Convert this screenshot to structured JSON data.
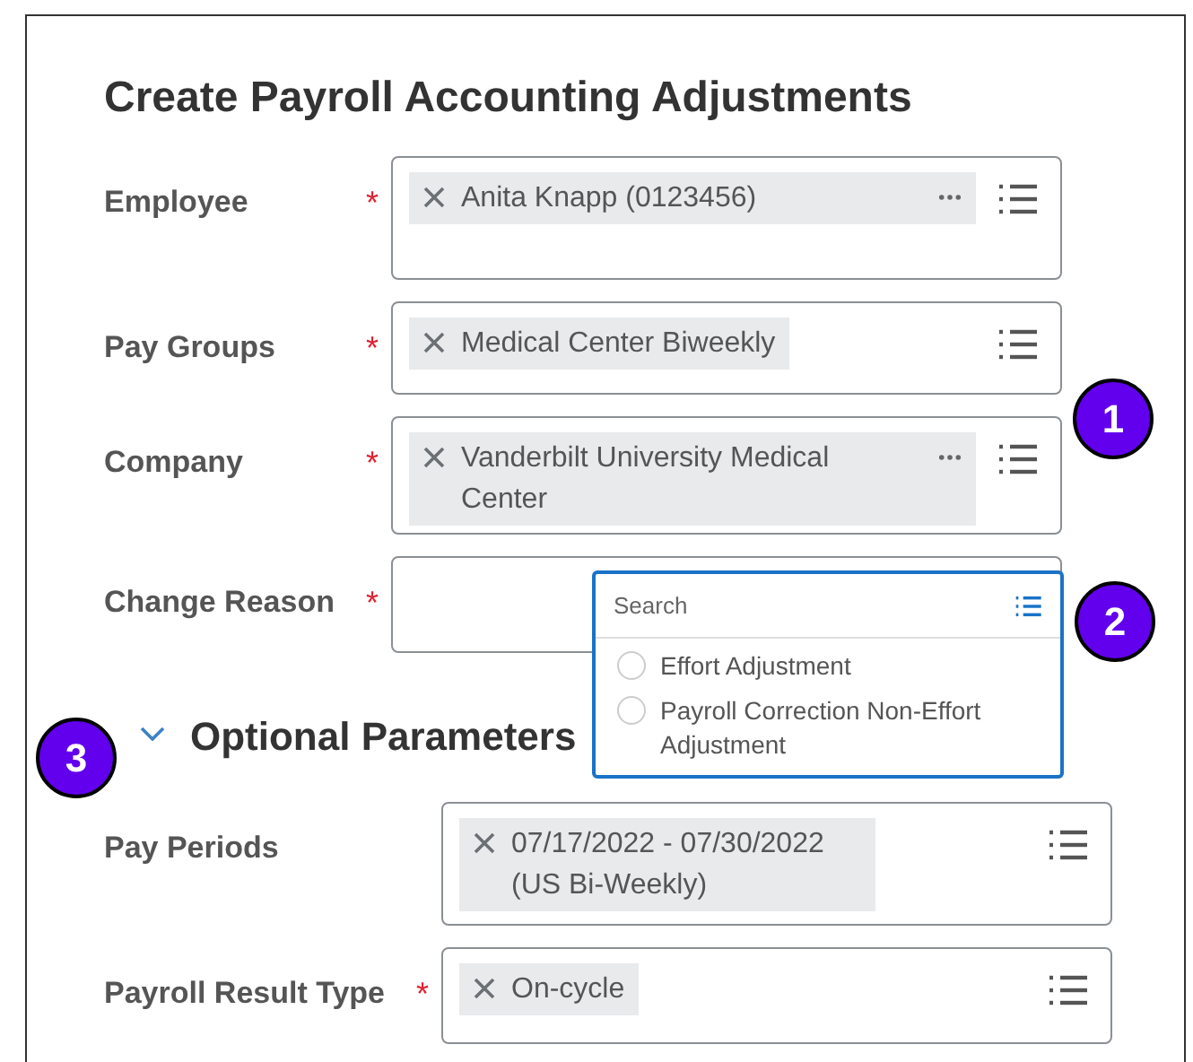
{
  "title": "Create Payroll Accounting Adjustments",
  "fields": [
    {
      "label": "Employee",
      "required_mark": "*",
      "values": [
        {
          "text": "Anita Knapp (0123456)",
          "more": true
        }
      ]
    },
    {
      "label": "Pay Groups",
      "required_mark": "*",
      "values": [
        {
          "text": "Medical Center Biweekly",
          "more": false
        }
      ]
    },
    {
      "label": "Company",
      "required_mark": "*",
      "values": [
        {
          "text": "Vanderbilt University Medical Center",
          "more": true
        }
      ]
    },
    {
      "label": "Change Reason",
      "required_mark": "*"
    }
  ],
  "dropdown": {
    "placeholder": "Search",
    "options": [
      {
        "label": "Effort Adjustment",
        "selected": false
      },
      {
        "label": "Payroll Correction Non-Effort Adjustment",
        "selected": false
      }
    ]
  },
  "optional_section": {
    "title": "Optional Parameters",
    "expanded": true,
    "fields": [
      {
        "label": "Pay Periods",
        "values": [
          {
            "text": "07/17/2022 - 07/30/2022 (US Bi-Weekly)",
            "more": false
          }
        ]
      },
      {
        "label": "Payroll Result Type",
        "required_mark": "*",
        "values": [
          {
            "text": "On-cycle",
            "more": false
          }
        ]
      }
    ]
  },
  "callouts": [
    {
      "number": "1"
    },
    {
      "number": "2"
    },
    {
      "number": "3"
    }
  ]
}
